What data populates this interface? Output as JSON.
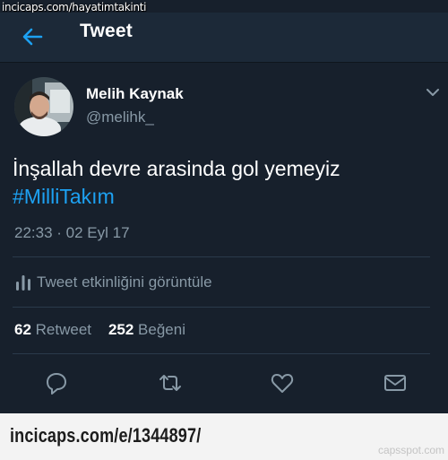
{
  "watermark": {
    "top_text": "incicaps.com/hayatimtakinti"
  },
  "header": {
    "back_icon": "arrow-left-icon",
    "title": "Tweet"
  },
  "colors": {
    "background": "#17202c",
    "header": "#1c2938",
    "accent": "#1da1f2",
    "secondary_text": "#8899a6"
  },
  "tweet": {
    "author_name": "Melih Kaynak",
    "author_handle": "@melihk_",
    "text": "İnşallah devre arasinda gol yemeyiz",
    "hashtag": "#MilliTakım",
    "timestamp": "22:33 · 02 Eyl 17",
    "activity_label": "Tweet etkinliğini görüntüle",
    "retweet_count": "62",
    "retweet_label": "Retweet",
    "like_count": "252",
    "like_label": "Beğeni",
    "actions": [
      "reply-icon",
      "retweet-icon",
      "like-icon",
      "direct-message-icon"
    ]
  },
  "footer": {
    "url": "incicaps.com/e/1344897/",
    "credit": "capsspot.com"
  }
}
